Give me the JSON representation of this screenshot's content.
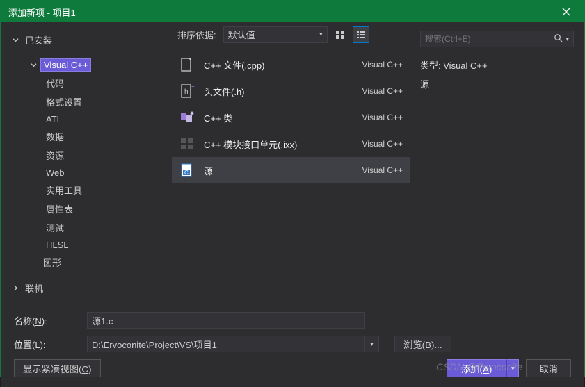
{
  "title": "添加新项 - 项目1",
  "sidebar": {
    "root": "已安装",
    "selected": "Visual C++",
    "children": [
      "代码",
      "格式设置",
      "ATL",
      "数据",
      "资源",
      "Web",
      "实用工具",
      "属性表",
      "测试",
      "HLSL"
    ],
    "subroot": "图形",
    "online": "联机"
  },
  "toolbar": {
    "sort_label": "排序依据:",
    "sort_value": "默认值"
  },
  "templates": [
    {
      "name": "C++ 文件(.cpp)",
      "lang": "Visual C++"
    },
    {
      "name": "头文件(.h)",
      "lang": "Visual C++"
    },
    {
      "name": "C++ 类",
      "lang": "Visual C++"
    },
    {
      "name": "C++ 模块接口单元(.ixx)",
      "lang": "Visual C++"
    },
    {
      "name": "源",
      "lang": "Visual C++"
    }
  ],
  "search_placeholder": "搜索(Ctrl+E)",
  "details": {
    "type_label": "类型:",
    "type_value": "Visual C++",
    "desc": "源"
  },
  "form": {
    "name_label": "名称(N):",
    "name_value": "源1.c",
    "loc_label": "位置(L):",
    "loc_value": "D:\\Ervoconite\\Project\\VS\\项目1",
    "browse": "浏览(B)..."
  },
  "actions": {
    "compact": "显示紧凑视图(C)",
    "add": "添加(A)",
    "cancel": "取消"
  },
  "watermark": "CSDN @Ervoconite"
}
